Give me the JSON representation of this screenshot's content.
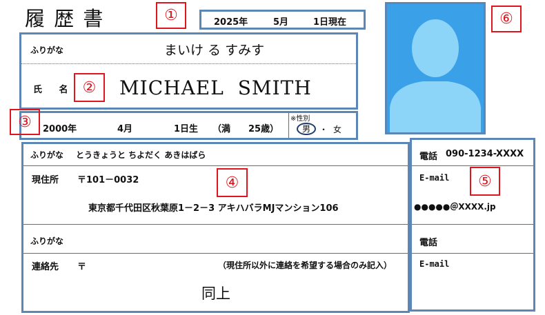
{
  "document": {
    "title": "履 歴 書",
    "date": {
      "year": "2025年",
      "month": "5月",
      "day": "1日現在"
    },
    "name_section": {
      "furigana_label": "ふりがな",
      "furigana_value": "まいけ る すみす",
      "name_label": "氏 名",
      "name_value": "MICHAEL SMITH"
    },
    "birth": {
      "year": "2000年",
      "month": "4月",
      "day": "1日生",
      "age_open": "（満",
      "age_value": "25歳）"
    },
    "gender": {
      "label": "※性別",
      "male": "男",
      "separator": "・",
      "female": "女"
    },
    "address": {
      "furigana_label": "ふりがな",
      "furigana_value": "とうきょうと ちよだく あきはばら",
      "current_label": "現住所",
      "postal": "〒101－0032",
      "line": "東京都千代田区秋葉原1－2－3 アキハバラMJマンション106"
    },
    "contact_address": {
      "furigana_label": "ふりがな",
      "label": "連絡先",
      "postal": "〒",
      "note": "（現住所以外に連絡を希望する場合のみ記入）",
      "value": "同上"
    },
    "phone": {
      "label1": "電話",
      "value1": "090-1234-XXXX",
      "email_label1": "E-mail",
      "email_value1": "●●●●●＠XXXX.jp",
      "label2": "電話",
      "email_label2": "E-mail"
    }
  },
  "annotations": [
    "①",
    "②",
    "③",
    "④",
    "⑤",
    "⑥"
  ],
  "colors": {
    "blue_frame": "#5b86b5",
    "red_marker": "#e0141c",
    "photo_bg": "#3aa0e8",
    "photo_silhouette": "#8cd4f8"
  }
}
